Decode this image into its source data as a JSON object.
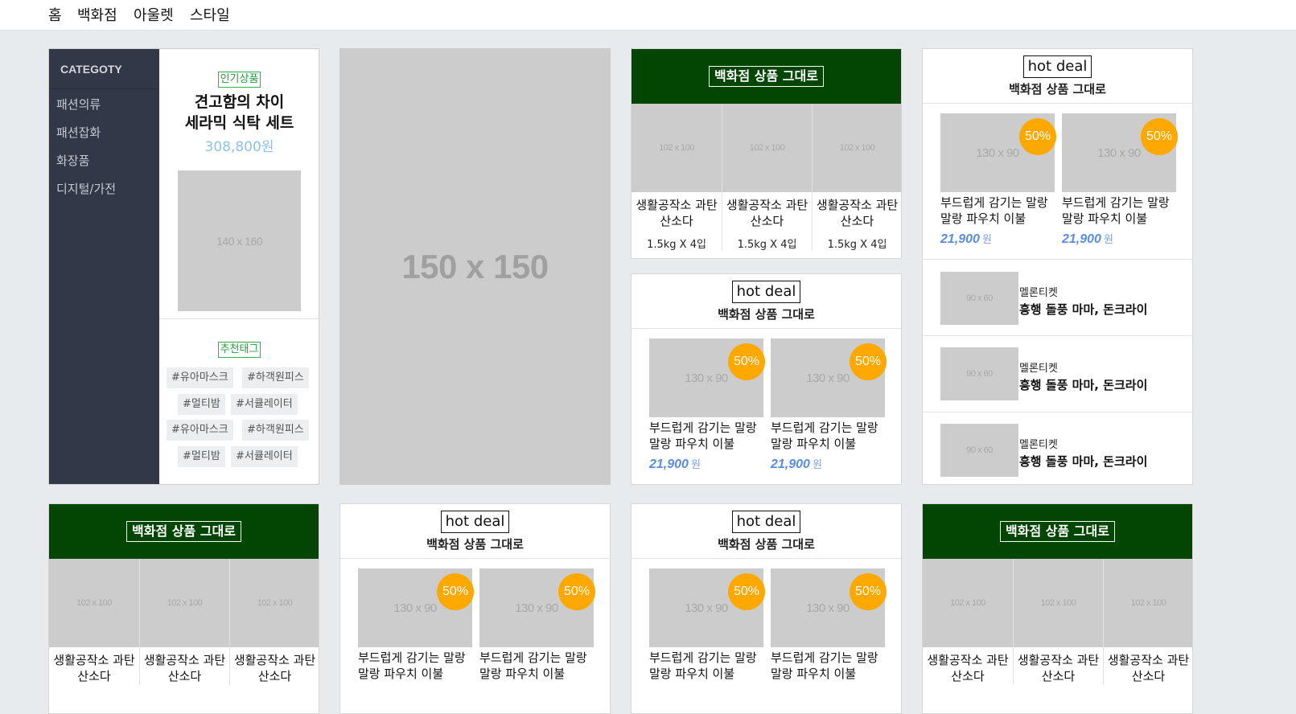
{
  "nav": [
    "홈",
    "백화점",
    "아울렛",
    "스타일"
  ],
  "category": {
    "title": "CATEGOTY",
    "items": [
      "패션의류",
      "패션잡화",
      "화장품",
      "디지털/가전"
    ]
  },
  "popular": {
    "tag": "인기상품",
    "title_line1": "견고함의 차이",
    "title_line2": "세라믹 식탁 세트",
    "price": "308,800원",
    "image": "140 x 160"
  },
  "recommend": {
    "tag": "추천태그",
    "chips": [
      "#유아마스크",
      "#하객원피스",
      "#멀티밤",
      "#서큘레이터",
      "#유아마스크",
      "#하객원피스",
      "#멀티밤",
      "#서큘레이터"
    ]
  },
  "banner": {
    "image": "150 x 150"
  },
  "dept": {
    "title": "백화점 상품 그대로",
    "image": "102 x 100",
    "name": "생활공작소 과탄\n산소다",
    "sub": "1.5kg X 4입"
  },
  "hotdeal": {
    "title": "hot deal",
    "subtitle": "백화점 상품 그대로",
    "image": "130 x 90",
    "badge": "50%",
    "name": "부드럽게 감기는 말랑\n말랑 파우치 이불",
    "price": "21,900",
    "won": "원"
  },
  "ticket": {
    "image": "90 x 60",
    "brand": "멜론티켓",
    "title": "흥행 돌풍 마마, 돈크라이"
  },
  "colors": {
    "dept_green": "#034503",
    "badge_orange": "#ffa800",
    "category_bg": "#323847",
    "price_blue": "#5a8de0"
  }
}
